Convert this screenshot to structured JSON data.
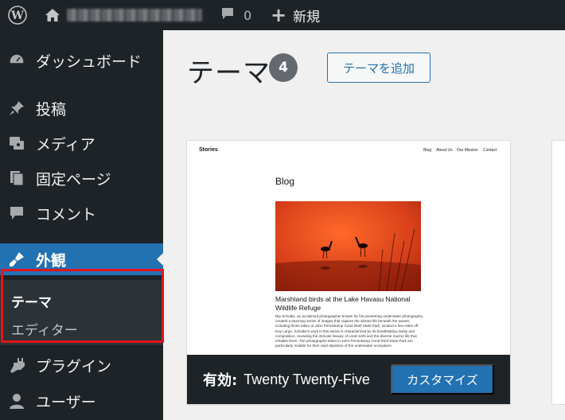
{
  "adminbar": {
    "comment_count": "0",
    "new_label": "新規"
  },
  "sidebar": {
    "items": [
      {
        "label": "ダッシュボード",
        "icon": "dashboard-icon"
      },
      {
        "label": "投稿",
        "icon": "pin-icon"
      },
      {
        "label": "メディア",
        "icon": "media-icon"
      },
      {
        "label": "固定ページ",
        "icon": "pages-icon"
      },
      {
        "label": "コメント",
        "icon": "comment-icon"
      },
      {
        "label": "外観",
        "icon": "appearance-icon"
      },
      {
        "label": "プラグイン",
        "icon": "plugin-icon"
      },
      {
        "label": "ユーザー",
        "icon": "users-icon"
      }
    ],
    "submenu": [
      {
        "label": "テーマ"
      },
      {
        "label": "エディター"
      }
    ]
  },
  "main": {
    "title": "テーマ",
    "theme_count": "4",
    "add_button": "テーマを追加"
  },
  "theme": {
    "screenshot": {
      "site_title": "Stories",
      "nav": [
        "Blog",
        "About Us",
        "Our Mission",
        "Contact"
      ],
      "heading": "Blog",
      "post_title": "Marshland birds at the Lake Havasu National Wildlife Refuge",
      "post_body": "Rip Schulke, an acclaimed photographer known for his pioneering underwater photography, created a stunning series of images that capture the vibrant life beneath the waves, including those taken at John Pennekamp Coral Reef State Park, located a few miles off Key Largo. Schulke's work in this series is characterized by its breathtaking clarity and composition, revealing the intricate beauty of coral reefs and the diverse marine life that inhabits them. The photographs taken in John Pennekamp Coral Reef State Park are particularly notable for their vivid depiction of the underwater ecosystem."
    },
    "active_label": "有効:",
    "active_name": "Twenty Twenty-Five",
    "customize_button": "カスタマイズ"
  },
  "colors": {
    "admin_dark": "#1d2327",
    "accent_blue": "#2271b1",
    "highlight_red": "#e1141b"
  }
}
